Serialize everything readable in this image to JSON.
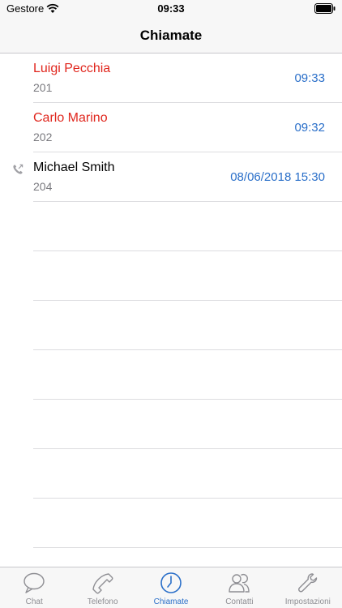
{
  "status_bar": {
    "carrier": "Gestore",
    "time": "09:33",
    "icons": [
      "wifi-icon",
      "battery-icon"
    ]
  },
  "nav": {
    "title": "Chiamate"
  },
  "calls": [
    {
      "name": "Luigi Pecchia",
      "extension": "201",
      "time": "09:33",
      "missed": true,
      "type_icon": ""
    },
    {
      "name": "Carlo Marino",
      "extension": "202",
      "time": "09:32",
      "missed": true,
      "type_icon": ""
    },
    {
      "name": "Michael Smith",
      "extension": "204",
      "time": "08/06/2018 15:30",
      "missed": false,
      "type_icon": "outgoing-call-icon"
    }
  ],
  "tabs": [
    {
      "label": "Chat",
      "icon": "chat-bubble-icon",
      "active": false
    },
    {
      "label": "Telefono",
      "icon": "phone-handset-icon",
      "active": false
    },
    {
      "label": "Chiamate",
      "icon": "clock-icon",
      "active": true
    },
    {
      "label": "Contatti",
      "icon": "contacts-icon",
      "active": false
    },
    {
      "label": "Impostazioni",
      "icon": "wrench-icon",
      "active": false
    }
  ],
  "colors": {
    "missed": "#e0261d",
    "accent": "#2a6fc9",
    "secondary_text": "#7a7a7f",
    "bar_background": "#f7f7f7"
  }
}
